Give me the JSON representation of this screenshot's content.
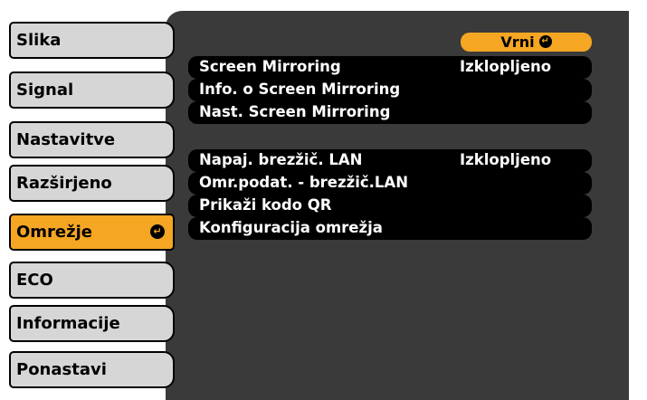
{
  "sidebar": {
    "items": [
      {
        "label": "Slika"
      },
      {
        "label": "Signal"
      },
      {
        "label": "Nastavitve"
      },
      {
        "label": "Razširjeno"
      },
      {
        "label": "Omrežje",
        "active": true
      },
      {
        "label": "ECO"
      },
      {
        "label": "Informacije"
      },
      {
        "label": "Ponastavi"
      }
    ],
    "active_color": "#f5a623",
    "enter_icon": "enter-icon"
  },
  "main": {
    "back_label": "Vrni",
    "group1": [
      {
        "label": "Screen Mirroring",
        "value": "Izklopljeno"
      },
      {
        "label": "Info. o Screen Mirroring"
      },
      {
        "label": "Nast. Screen Mirroring"
      }
    ],
    "group2": [
      {
        "label": "Napaj. brezžič. LAN",
        "value": "Izklopljeno"
      },
      {
        "label": "Omr.podat. - brezžič.LAN"
      },
      {
        "label": "Prikaži kodo QR"
      },
      {
        "label": "Konfiguracija omrežja"
      }
    ]
  },
  "colors": {
    "panel": "#3a3a3a",
    "tab": "#d6d6d6",
    "highlight": "#f5a623"
  }
}
